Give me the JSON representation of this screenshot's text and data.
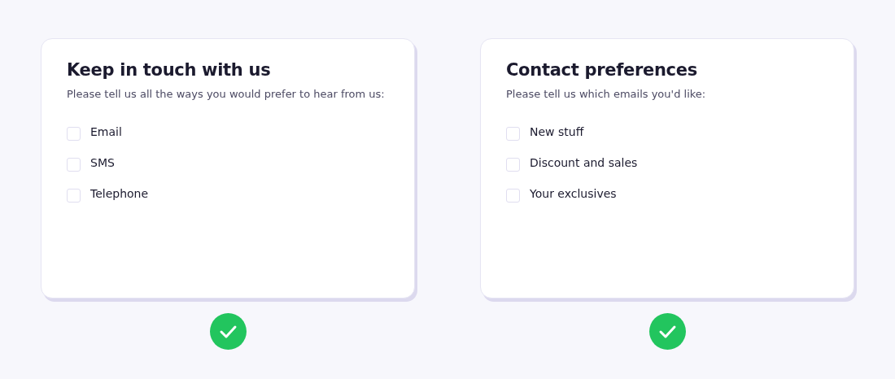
{
  "cards": [
    {
      "title": "Keep in touch with us",
      "subtitle": "Please tell us all the ways you would prefer to hear from us:",
      "options": [
        {
          "label": "Email",
          "checked": false
        },
        {
          "label": "SMS",
          "checked": false
        },
        {
          "label": "Telephone",
          "checked": false
        }
      ],
      "valid": true
    },
    {
      "title": "Contact preferences",
      "subtitle": "Please tell us which emails you'd like:",
      "options": [
        {
          "label": "New stuff",
          "checked": false
        },
        {
          "label": "Discount and sales",
          "checked": false
        },
        {
          "label": "Your exclusives",
          "checked": false
        }
      ],
      "valid": true
    }
  ]
}
